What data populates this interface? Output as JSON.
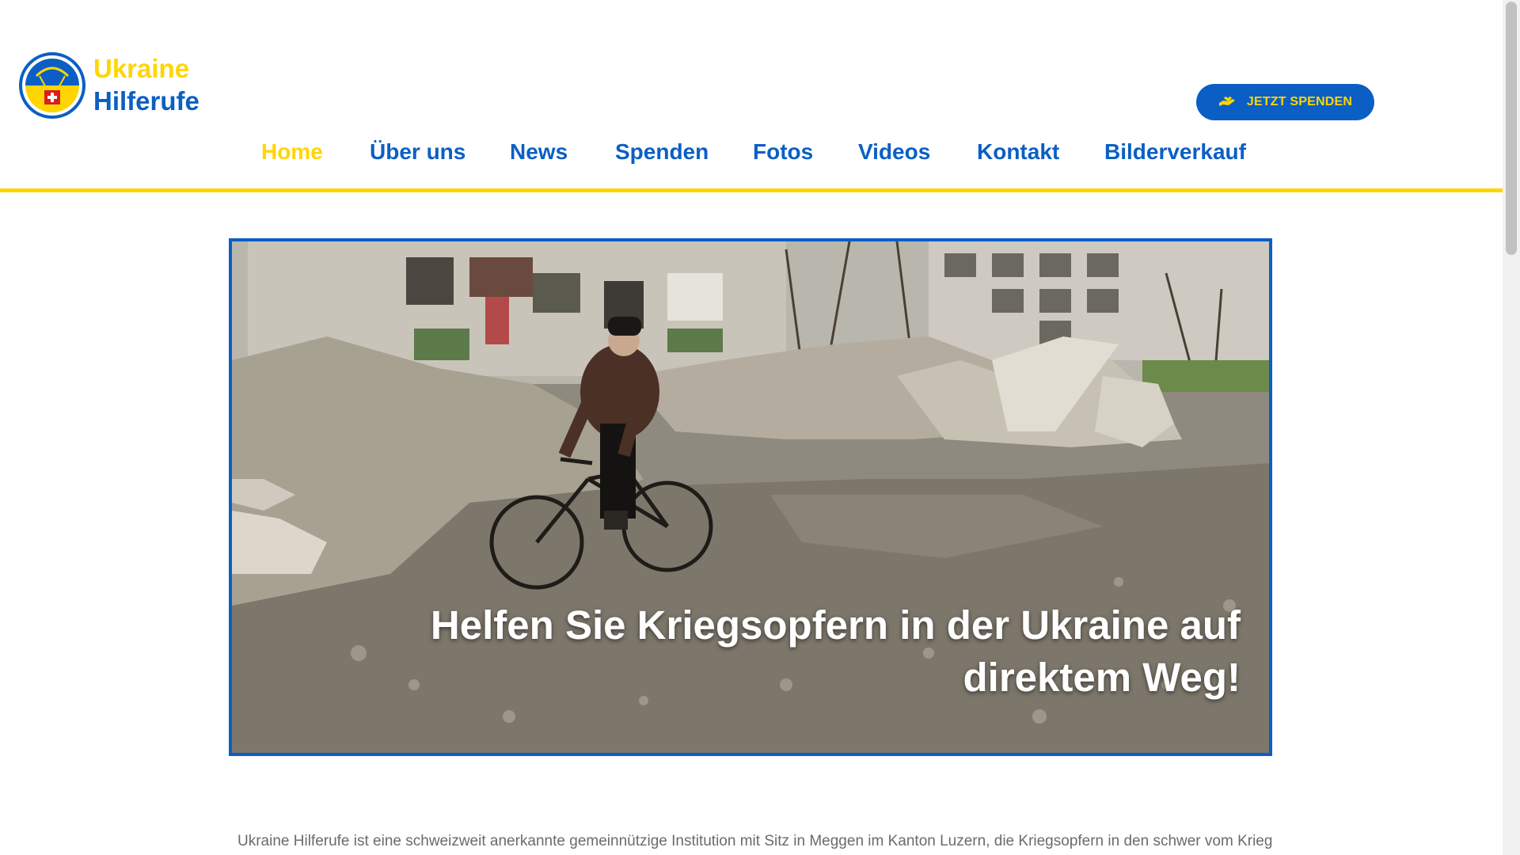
{
  "logo": {
    "line1": "Ukraine",
    "line2": "Hilferufe",
    "colors": {
      "yellow": "#ffd500",
      "blue": "#0b5fc4",
      "red": "#d81e1e"
    }
  },
  "donate_button": {
    "label": "JETZT SPENDEN",
    "icon": "hand-heart-icon"
  },
  "nav": {
    "items": [
      {
        "label": "Home",
        "active": true
      },
      {
        "label": "Über uns",
        "active": false
      },
      {
        "label": "News",
        "active": false
      },
      {
        "label": "Spenden",
        "active": false
      },
      {
        "label": "Fotos",
        "active": false
      },
      {
        "label": "Videos",
        "active": false
      },
      {
        "label": "Kontakt",
        "active": false
      },
      {
        "label": "Bilderverkauf",
        "active": false
      }
    ]
  },
  "hero": {
    "title_line1": "Helfen Sie Kriegsopfern in der Ukraine auf",
    "title_line2": "direktem Weg!"
  },
  "intro": {
    "text": "Ukraine Hilferufe ist eine schweizweit anerkannte gemeinnützige Institution mit Sitz in Meggen im Kanton Luzern, die Kriegsopfern in den schwer vom Krieg"
  }
}
